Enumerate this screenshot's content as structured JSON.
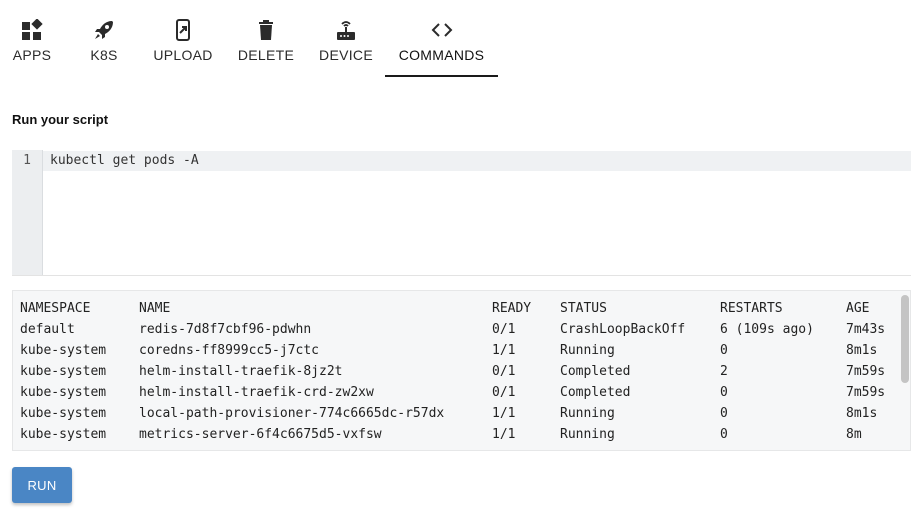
{
  "tabs": [
    {
      "label": "APPS",
      "icon": "widgets-icon"
    },
    {
      "label": "K8S",
      "icon": "rocket-icon"
    },
    {
      "label": "UPLOAD",
      "icon": "phone-upload-icon"
    },
    {
      "label": "DELETE",
      "icon": "trash-icon"
    },
    {
      "label": "DEVICE",
      "icon": "router-icon"
    },
    {
      "label": "COMMANDS",
      "icon": "code-icon"
    }
  ],
  "active_tab": "COMMANDS",
  "section_title": "Run your script",
  "editor": {
    "line_number": "1",
    "code": "kubectl get pods -A"
  },
  "output": {
    "headers": [
      "NAMESPACE",
      "NAME",
      "READY",
      "STATUS",
      "RESTARTS",
      "AGE"
    ],
    "rows": [
      [
        "default",
        "redis-7d8f7cbf96-pdwhn",
        "0/1",
        "CrashLoopBackOff",
        "6 (109s ago)",
        "7m43s"
      ],
      [
        "kube-system",
        "coredns-ff8999cc5-j7ctc",
        "1/1",
        "Running",
        "0",
        "8m1s"
      ],
      [
        "kube-system",
        "helm-install-traefik-8jz2t",
        "0/1",
        "Completed",
        "2",
        "7m59s"
      ],
      [
        "kube-system",
        "helm-install-traefik-crd-zw2xw",
        "0/1",
        "Completed",
        "0",
        "7m59s"
      ],
      [
        "kube-system",
        "local-path-provisioner-774c6665dc-r57dx",
        "1/1",
        "Running",
        "0",
        "8m1s"
      ],
      [
        "kube-system",
        "metrics-server-6f4c6675d5-vxfsw",
        "1/1",
        "Running",
        "0",
        "8m"
      ]
    ]
  },
  "run_button": "RUN",
  "colors": {
    "accent": "#4a86c5",
    "tab_indicator": "#1a1a1a",
    "output_bg": "#f6f7f8"
  }
}
